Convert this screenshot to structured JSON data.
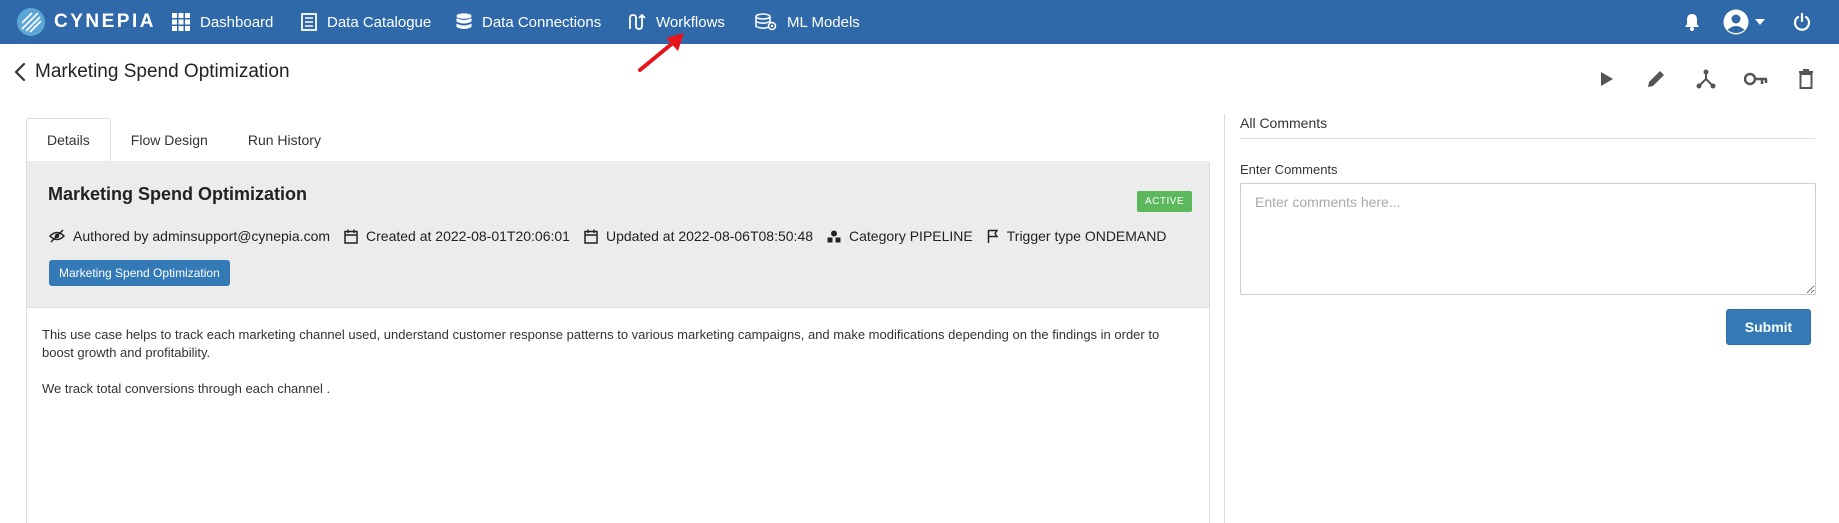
{
  "brand": {
    "name": "CYNEPIA"
  },
  "nav": {
    "items": [
      {
        "label": "Dashboard",
        "icon": "grid-icon"
      },
      {
        "label": "Data Catalogue",
        "icon": "catalogue-icon"
      },
      {
        "label": "Data Connections",
        "icon": "database-icon"
      },
      {
        "label": "Workflows",
        "icon": "workflow-icon"
      },
      {
        "label": "ML Models",
        "icon": "ml-models-icon"
      }
    ],
    "right_icons": [
      "bell-icon",
      "user-account-icon",
      "power-icon"
    ]
  },
  "page": {
    "title": "Marketing Spend Optimization",
    "actions": [
      "play-icon",
      "edit-icon",
      "fork-icon",
      "key-icon",
      "trash-icon"
    ]
  },
  "tabs": [
    {
      "label": "Details",
      "active": true
    },
    {
      "label": "Flow Design",
      "active": false
    },
    {
      "label": "Run History",
      "active": false
    }
  ],
  "details": {
    "name": "Marketing Spend Optimization",
    "status": "ACTIVE",
    "author": "Authored by adminsupport@cynepia.com",
    "created": "Created at 2022-08-01T20:06:01",
    "updated": "Updated at 2022-08-06T08:50:48",
    "category": "Category PIPELINE",
    "trigger": "Trigger type ONDEMAND",
    "tag": "Marketing Spend Optimization",
    "description": [
      "This use case helps to track each marketing channel used, understand customer response patterns to various marketing campaigns, and make modifications depending on the findings in order to boost growth and profitability.",
      "We track total conversions through each channel ."
    ]
  },
  "comments": {
    "title": "All Comments",
    "input_label": "Enter Comments",
    "placeholder": "Enter comments here...",
    "submit_label": "Submit"
  },
  "colors": {
    "navbar": "#2f69aa",
    "primary": "#337ab7",
    "active_badge": "#5cb85c",
    "annotation_arrow": "#e8141b"
  }
}
